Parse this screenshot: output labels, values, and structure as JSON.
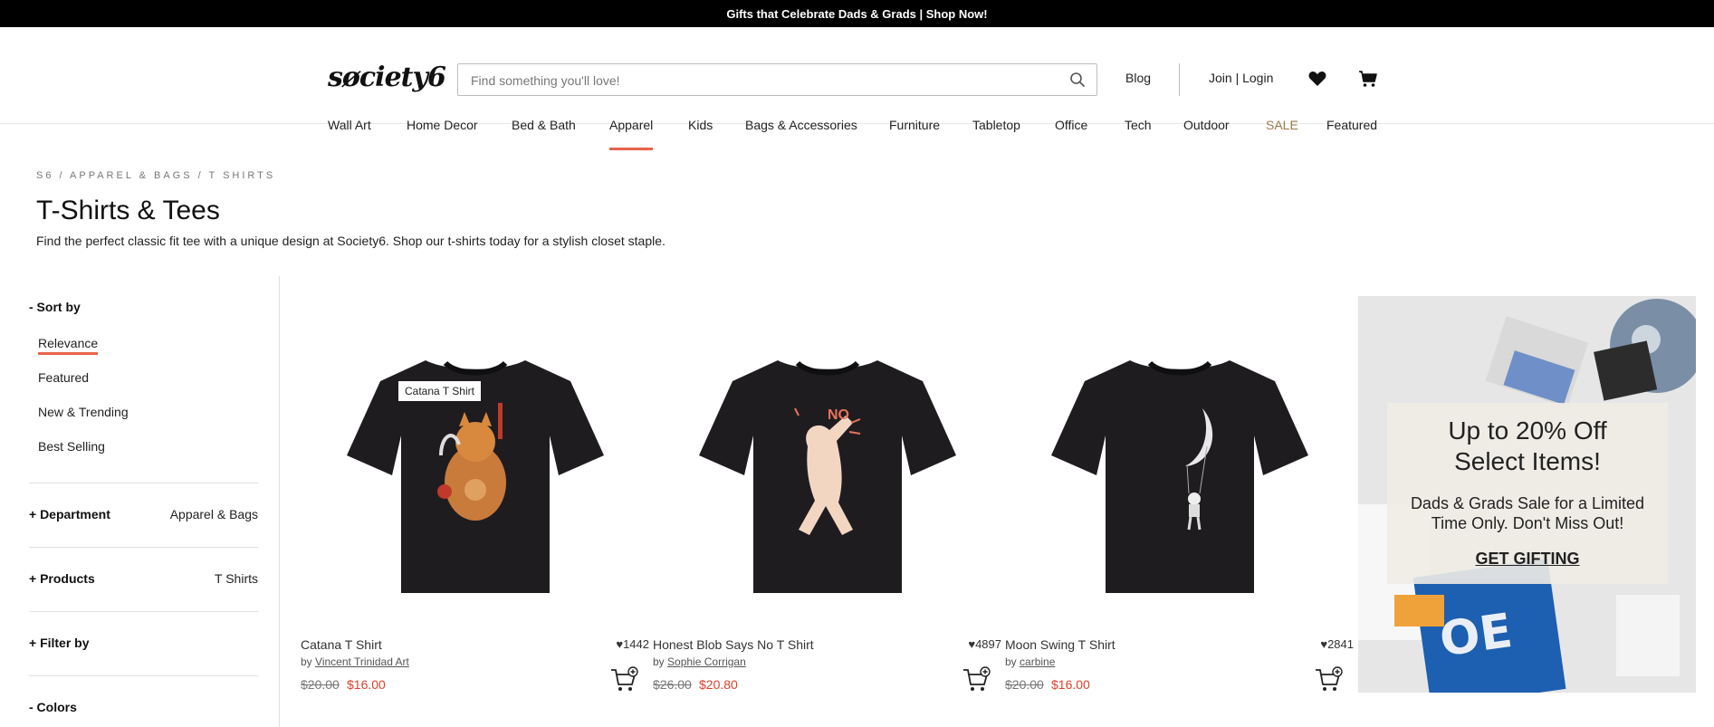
{
  "promo_bar": {
    "text": "Gifts that Celebrate Dads & Grads | Shop Now!"
  },
  "header": {
    "logo": "søciety6",
    "search_placeholder": "Find something you'll love!",
    "blog": "Blog",
    "login": "Join | Login"
  },
  "categories": [
    "Wall Art",
    "Home Decor",
    "Bed & Bath",
    "Apparel",
    "Kids",
    "Bags & Accessories",
    "Furniture",
    "Tabletop",
    "Office",
    "Tech",
    "Outdoor",
    "SALE",
    "Featured"
  ],
  "breadcrumb": "S6 / APPAREL & BAGS / T SHIRTS",
  "page": {
    "title": "T-Shirts & Tees",
    "description": "Find the perfect classic fit tee with a unique design at Society6. Shop our t-shirts today for a stylish closet staple."
  },
  "sidebar": {
    "sort_heading": "- Sort by",
    "sort_options": [
      "Relevance",
      "Featured",
      "New & Trending",
      "Best Selling"
    ],
    "department_heading": "+ Department",
    "department_value": "Apparel & Bags",
    "products_heading": "+ Products",
    "products_value": "T Shirts",
    "filter_heading": "+ Filter by",
    "colors_heading": "- Colors"
  },
  "products": [
    {
      "title": "Catana T Shirt",
      "likes": "1442",
      "by_prefix": "by",
      "artist": "Vincent Trinidad Art",
      "original_price": "$20.00",
      "sale_price": "$16.00"
    },
    {
      "title": "Honest Blob Says No T Shirt",
      "likes": "4897",
      "by_prefix": "by",
      "artist": "Sophie Corrigan",
      "original_price": "$26.00",
      "sale_price": "$20.80"
    },
    {
      "title": "Moon Swing T Shirt",
      "likes": "2841",
      "by_prefix": "by",
      "artist": "carbine",
      "original_price": "$20.00",
      "sale_price": "$16.00"
    }
  ],
  "tooltip": "Catana T Shirt",
  "promo_panel": {
    "headline_line1": "Up to 20% Off",
    "headline_line2": "Select Items!",
    "sub_line1": "Dads & Grads Sale for a Limited",
    "sub_line2": "Time Only. Don't Miss Out!",
    "cta": "GET GIFTING"
  },
  "colors": {
    "accent": "#e8634a",
    "sale_price": "#e0402a",
    "sale_nav": "#9a7a4a",
    "shirt": "#1f1c20"
  }
}
